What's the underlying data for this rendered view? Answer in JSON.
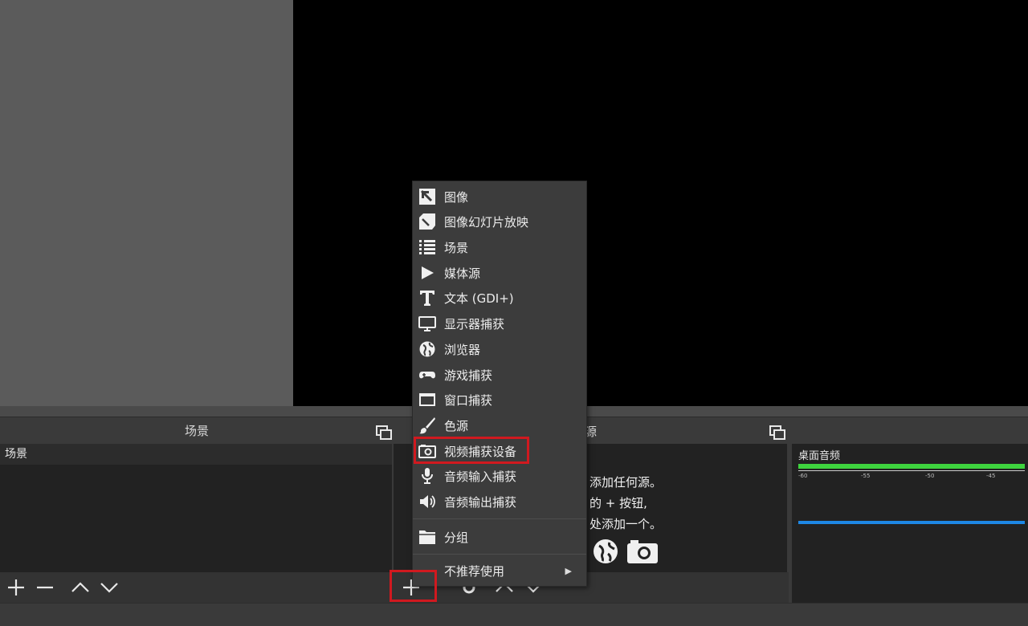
{
  "scenes_panel": {
    "title": "场景",
    "items": [
      "场景"
    ]
  },
  "sources_panel": {
    "title_partial": "源",
    "empty_lines": [
      "添加任何源。",
      "的 + 按钮,",
      "处添加一个。"
    ]
  },
  "mixer_panel": {
    "track_label": "桌面音频",
    "scale": [
      "-60",
      "-55",
      "-50",
      "-45"
    ]
  },
  "context_menu": {
    "items": [
      {
        "label": "图像",
        "icon": "image-icon"
      },
      {
        "label": "图像幻灯片放映",
        "icon": "slideshow-icon"
      },
      {
        "label": "场景",
        "icon": "list-icon"
      },
      {
        "label": "媒体源",
        "icon": "play-icon"
      },
      {
        "label": "文本 (GDI+)",
        "icon": "text-icon"
      },
      {
        "label": "显示器捕获",
        "icon": "monitor-icon"
      },
      {
        "label": "浏览器",
        "icon": "globe-icon"
      },
      {
        "label": "游戏捕获",
        "icon": "gamepad-icon"
      },
      {
        "label": "窗口捕获",
        "icon": "window-icon"
      },
      {
        "label": "色源",
        "icon": "brush-icon"
      },
      {
        "label": "视频捕获设备",
        "icon": "camera-icon",
        "highlighted": true
      },
      {
        "label": "音频输入捕获",
        "icon": "microphone-icon"
      },
      {
        "label": "音频输出捕获",
        "icon": "speaker-icon"
      },
      {
        "label": "分组",
        "icon": "folder-icon"
      },
      {
        "label": "不推荐使用",
        "icon": "",
        "submenu": true
      }
    ]
  },
  "colors": {
    "highlight_red": "#d0191f",
    "meter_green": "#3ed43e",
    "meter_blue": "#1e88e5"
  }
}
